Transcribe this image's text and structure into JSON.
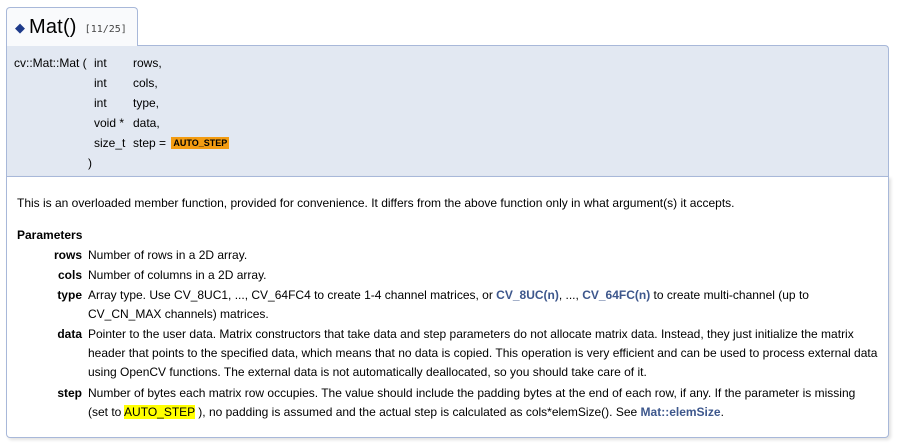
{
  "header": {
    "diamond": "◆",
    "title": "Mat()",
    "counter": "[11/25]"
  },
  "prototype": {
    "function": "cv::Mat::Mat (",
    "params": [
      {
        "type": "int",
        "name": "rows,"
      },
      {
        "type": "int",
        "name": "cols,"
      },
      {
        "type": "int",
        "name": "type,"
      },
      {
        "type": "void *",
        "name": "data,"
      },
      {
        "type": "size_t",
        "name": "step = ",
        "default_tag": "AUTO_STEP"
      }
    ],
    "close": ")"
  },
  "doc": {
    "intro": "This is an overloaded member function, provided for convenience. It differs from the above function only in what argument(s) it accepts.",
    "params_heading": "Parameters",
    "params": {
      "rows": {
        "name": "rows",
        "desc": "Number of rows in a 2D array."
      },
      "cols": {
        "name": "cols",
        "desc": "Number of columns in a 2D array."
      },
      "type": {
        "name": "type",
        "desc_a": "Array type. Use CV_8UC1, ..., CV_64FC4 to create 1-4 channel matrices, or ",
        "link1": "CV_8UC(n)",
        "desc_b": ", ..., ",
        "link2": "CV_64FC(n)",
        "desc_c": " to create multi-channel (up to CV_CN_MAX channels) matrices."
      },
      "data": {
        "name": "data",
        "desc": "Pointer to the user data. Matrix constructors that take data and step parameters do not allocate matrix data. Instead, they just initialize the matrix header that points to the specified data, which means that no data is copied. This operation is very efficient and can be used to process external data using OpenCV functions. The external data is not automatically deallocated, so you should take care of it."
      },
      "step": {
        "name": "step",
        "desc_a": "Number of bytes each matrix row occupies. The value should include the padding bytes at the end of each row, if any. If the parameter is missing (set to ",
        "highlight": "AUTO_STEP",
        "desc_b": " ), no padding is assumed and the actual step is calculated as cols*elemSize(). See ",
        "link": "Mat::elemSize",
        "desc_c": "."
      }
    }
  }
}
